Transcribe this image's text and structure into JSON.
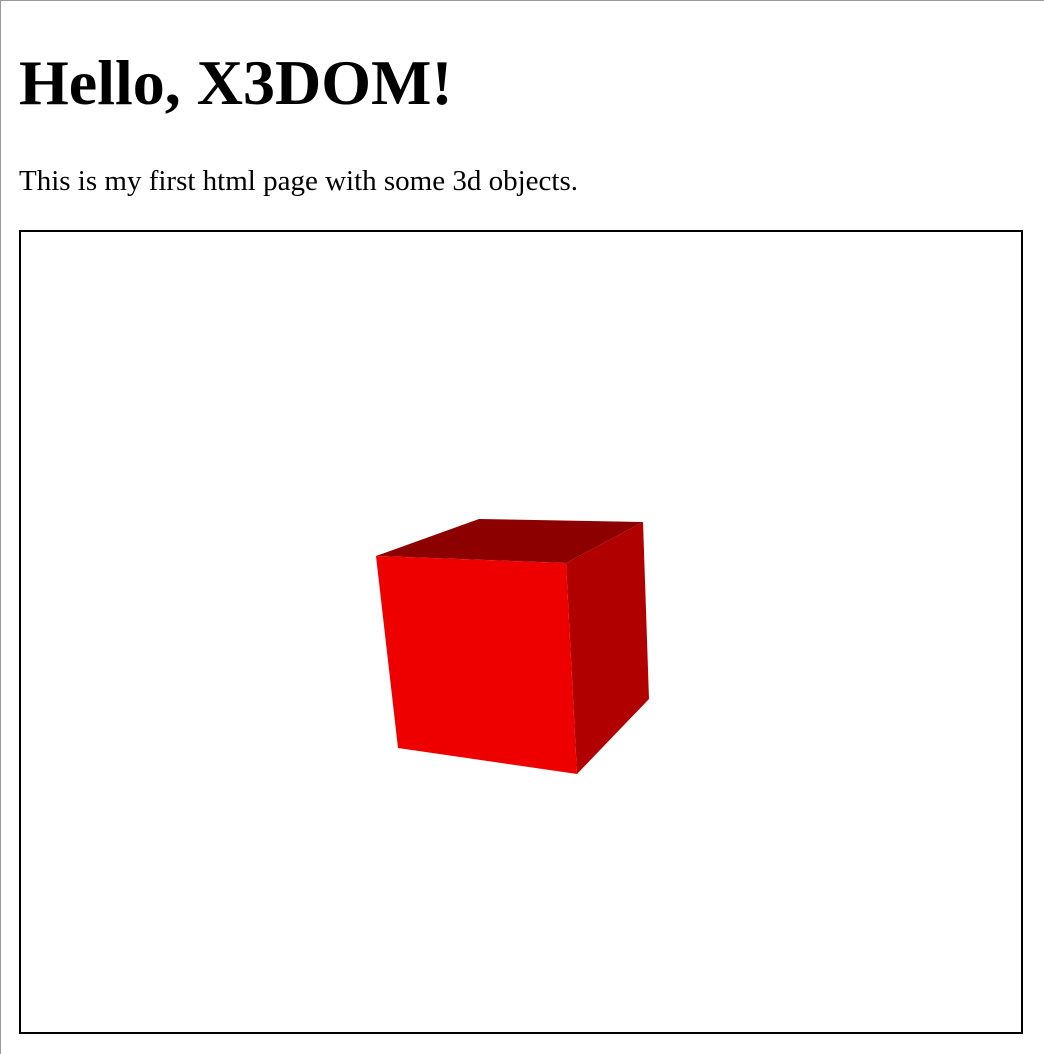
{
  "page": {
    "title": "Hello, X3DOM!",
    "intro": "This is my first html page with some 3d objects."
  },
  "scene": {
    "shape": "box",
    "material_color": "#ff0000",
    "faces": {
      "front": "#ee0000",
      "top": "#8c0000",
      "right": "#b00000"
    },
    "background": "#ffffff"
  }
}
